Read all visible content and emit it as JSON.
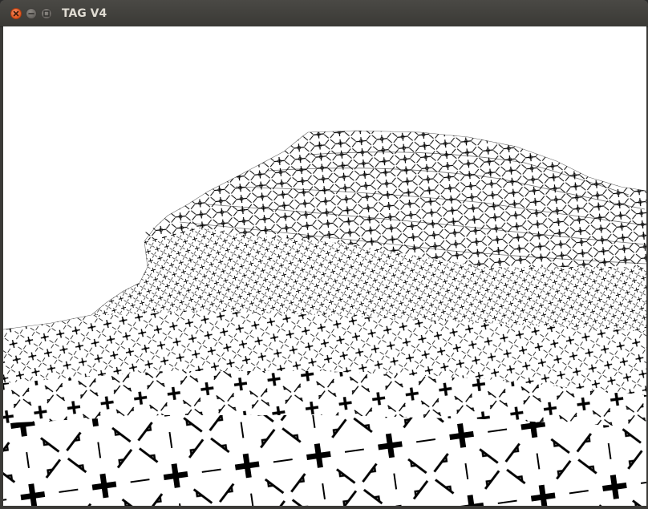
{
  "window": {
    "title": "TAG V4",
    "controls": {
      "close_icon": "close-icon",
      "minimize_icon": "minimize-icon",
      "maximize_icon": "maximize-icon"
    }
  },
  "scene": {
    "background_color": "#ffffff",
    "texture_ink_color": "#000000",
    "texture_pattern": [
      "plus-cross",
      "diagonal-x-lines",
      "corner-brackets",
      "dot-circle"
    ]
  }
}
